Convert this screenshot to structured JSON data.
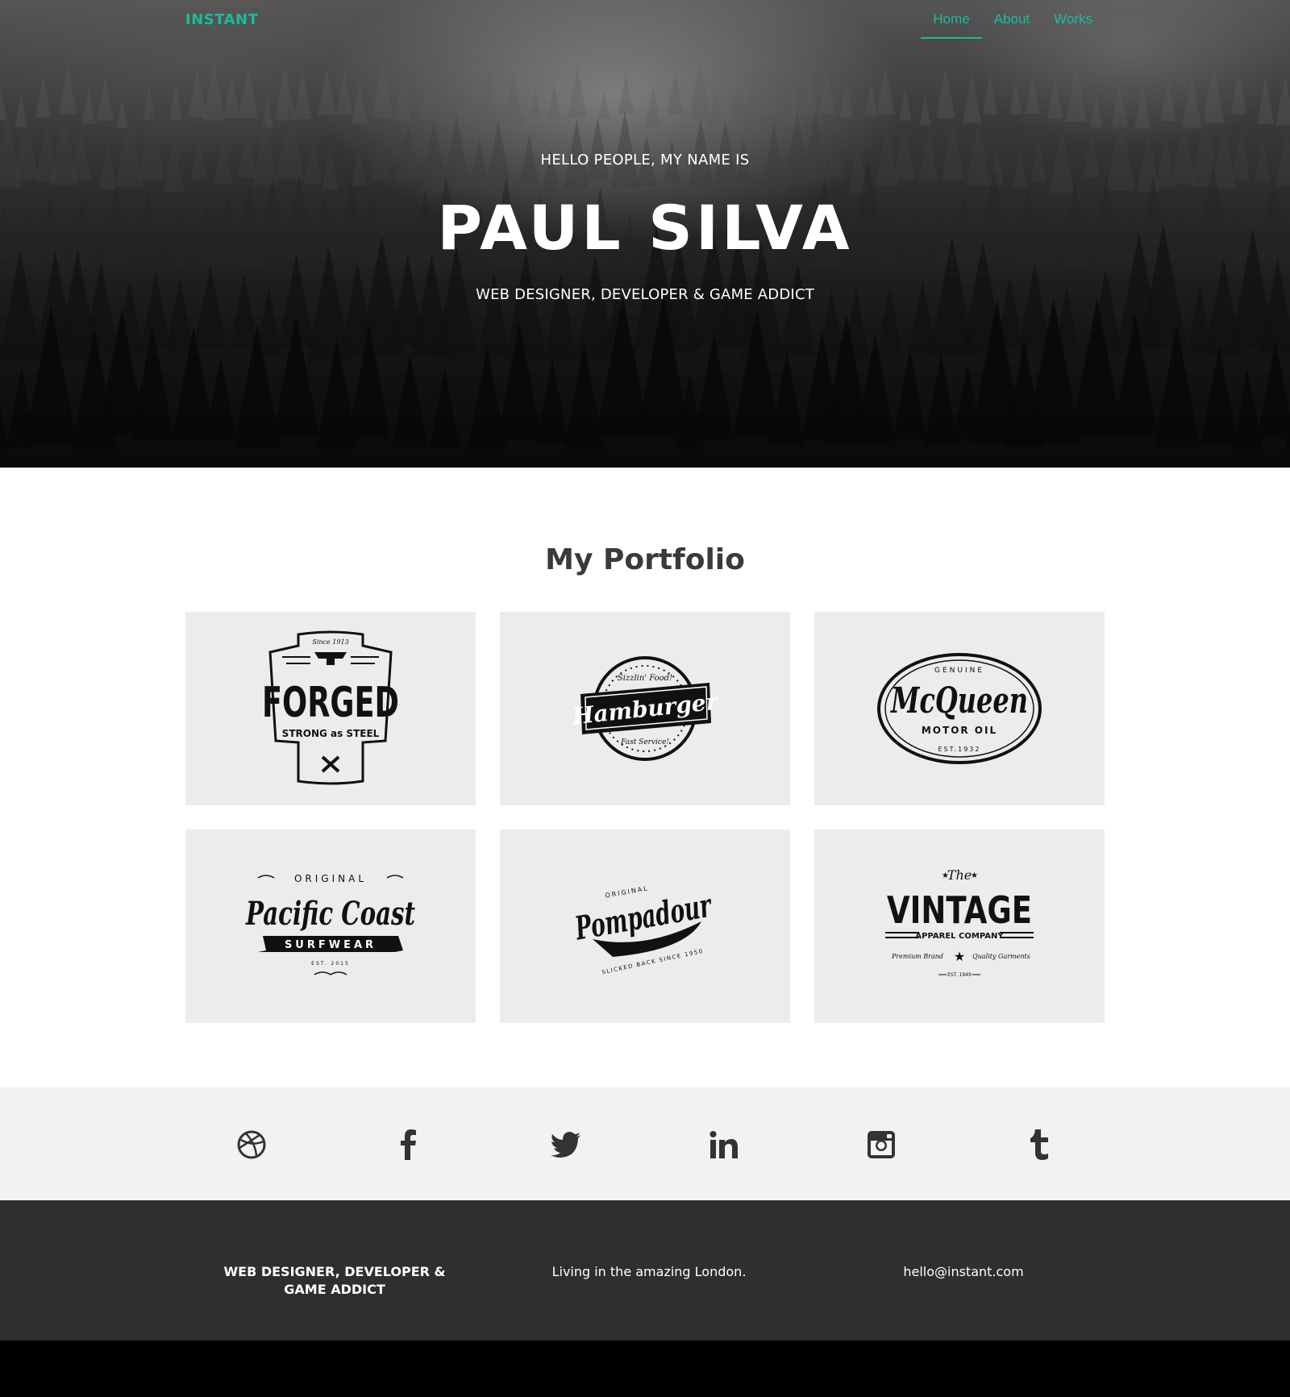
{
  "nav": {
    "brand": "INSTANT",
    "links": [
      {
        "label": "Home",
        "active": true
      },
      {
        "label": "About",
        "active": false
      },
      {
        "label": "Works",
        "active": false
      }
    ]
  },
  "hero": {
    "greeting": "HELLO PEOPLE, MY NAME IS",
    "name": "PAUL SILVA",
    "tagline": "WEB DESIGNER, DEVELOPER & GAME ADDICT"
  },
  "portfolio": {
    "title": "My Portfolio",
    "items": [
      {
        "logo_main": "FORGED",
        "logo_top": "Since 1913",
        "logo_sub": "STRONG as STEEL"
      },
      {
        "logo_main": "Hamburger",
        "logo_top": "Sizzlin' Food!",
        "logo_sub": "Fast Service!"
      },
      {
        "logo_main": "McQueen",
        "logo_top": "GENUINE",
        "logo_sub": "MOTOR OIL",
        "logo_bottom": "EST.1932"
      },
      {
        "logo_main": "Pacific Coast",
        "logo_top": "ORIGINAL",
        "logo_sub": "SURFWEAR",
        "logo_bottom": "EST. 2015"
      },
      {
        "logo_main": "Pompadour",
        "logo_top": "ORIGINAL",
        "logo_sub": "SLICKED BACK SINCE 1950"
      },
      {
        "logo_main": "VINTAGE",
        "logo_top": "The",
        "logo_sub": "APPAREL COMPANY",
        "logo_left": "Premium Brand",
        "logo_right": "Quality Garments",
        "logo_bottom": "EST. 1949"
      }
    ]
  },
  "social": {
    "icons": [
      "dribbble-icon",
      "facebook-icon",
      "twitter-icon",
      "linkedin-icon",
      "instagram-icon",
      "tumblr-icon"
    ]
  },
  "footer": {
    "role": "WEB DESIGNER, DEVELOPER & GAME ADDICT",
    "location": "Living in the amazing London.",
    "email": "hello@instant.com"
  },
  "colors": {
    "accent": "#1abc9c",
    "tile_bg": "#ececec",
    "social_bg": "#f2f2f2",
    "footer_bg": "#2f2f30"
  }
}
